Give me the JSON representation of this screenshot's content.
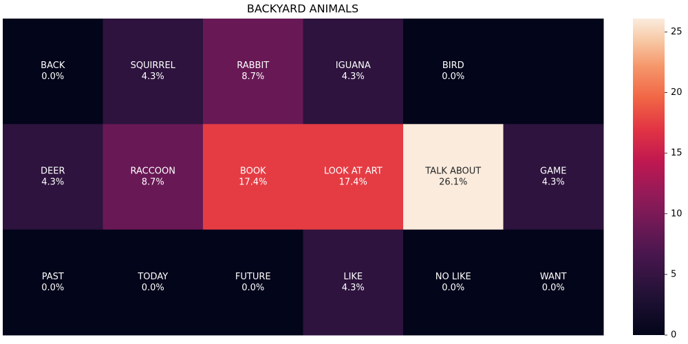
{
  "chart_data": {
    "type": "heatmap",
    "title": "BACKYARD ANIMALS",
    "rows": 3,
    "cols": 6,
    "cells": [
      [
        {
          "label": "BACK",
          "value": 0.0,
          "text": "0.0%"
        },
        {
          "label": "SQUIRREL",
          "value": 4.3,
          "text": "4.3%"
        },
        {
          "label": "RABBIT",
          "value": 8.7,
          "text": "8.7%"
        },
        {
          "label": "IGUANA",
          "value": 4.3,
          "text": "4.3%"
        },
        {
          "label": "BIRD",
          "value": 0.0,
          "text": "0.0%"
        },
        {
          "label": "",
          "value": 0.0,
          "text": ""
        }
      ],
      [
        {
          "label": "DEER",
          "value": 4.3,
          "text": "4.3%"
        },
        {
          "label": "RACCOON",
          "value": 8.7,
          "text": "8.7%"
        },
        {
          "label": "BOOK",
          "value": 17.4,
          "text": "17.4%"
        },
        {
          "label": "LOOK AT ART",
          "value": 17.4,
          "text": "17.4%"
        },
        {
          "label": "TALK ABOUT",
          "value": 26.1,
          "text": "26.1%"
        },
        {
          "label": "GAME",
          "value": 4.3,
          "text": "4.3%"
        }
      ],
      [
        {
          "label": "PAST",
          "value": 0.0,
          "text": "0.0%"
        },
        {
          "label": "TODAY",
          "value": 0.0,
          "text": "0.0%"
        },
        {
          "label": "FUTURE",
          "value": 0.0,
          "text": "0.0%"
        },
        {
          "label": "LIKE",
          "value": 4.3,
          "text": "4.3%"
        },
        {
          "label": "NO LIKE",
          "value": 0.0,
          "text": "0.0%"
        },
        {
          "label": "WANT",
          "value": 0.0,
          "text": "0.0%"
        }
      ]
    ],
    "colorbar": {
      "min": 0,
      "max": 26.1,
      "ticks": [
        0,
        5,
        10,
        15,
        20,
        25
      ],
      "colormap": "rocket"
    },
    "colors": {
      "low": "#03051a",
      "high": "#faebdd"
    },
    "grid": false
  }
}
